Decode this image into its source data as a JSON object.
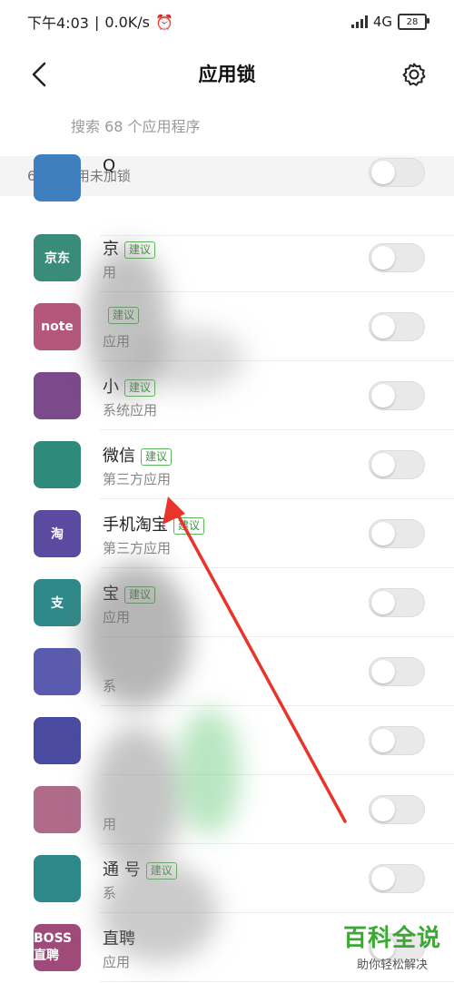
{
  "status_bar": {
    "time": "下午4:03",
    "speed": "0.0K/s",
    "network": "4G",
    "battery": "28"
  },
  "app_bar": {
    "title": "应用锁"
  },
  "search": {
    "placeholder": "搜索 68 个应用程序"
  },
  "section": {
    "header": "63 个应用未加锁"
  },
  "apps": [
    {
      "name": "Q",
      "tag": "",
      "subtitle": "",
      "icon_text": "",
      "icon_color": "#3f7fc0",
      "locked": false
    },
    {
      "name": "京",
      "tag": "建议",
      "subtitle": "用",
      "icon_text": "京东",
      "icon_color": "#3a8c7a",
      "locked": false
    },
    {
      "name": "",
      "tag": "建议",
      "subtitle": "应用",
      "icon_text": "note",
      "icon_color": "#b5577a",
      "locked": false
    },
    {
      "name": "小",
      "tag": "建议",
      "subtitle": "系统应用",
      "icon_text": "",
      "icon_color": "#7a4a8a",
      "locked": false
    },
    {
      "name": "微信",
      "tag": "建议",
      "subtitle": "第三方应用",
      "icon_text": "",
      "icon_color": "#2e8a7a",
      "locked": false
    },
    {
      "name": "手机淘宝",
      "tag": "建议",
      "subtitle": "第三方应用",
      "icon_text": "淘",
      "icon_color": "#5a4aa0",
      "locked": false
    },
    {
      "name": "宝",
      "tag": "建议",
      "subtitle": "应用",
      "icon_text": "支",
      "icon_color": "#2e8a8a",
      "locked": false
    },
    {
      "name": "",
      "tag": "",
      "subtitle": "系",
      "icon_text": "",
      "icon_color": "#5a5ab0",
      "locked": false
    },
    {
      "name": "",
      "tag": "",
      "subtitle": "",
      "icon_text": "",
      "icon_color": "#4a4aa0",
      "locked": false
    },
    {
      "name": "",
      "tag": "",
      "subtitle": "用",
      "icon_text": "",
      "icon_color": "#b06a8a",
      "locked": false
    },
    {
      "name": "通 号",
      "tag": "建议",
      "subtitle": "系",
      "icon_text": "",
      "icon_color": "#2e8a8a",
      "locked": false
    },
    {
      "name": "直聘",
      "tag": "",
      "subtitle": "应用",
      "icon_text": "BOSS直聘",
      "icon_color": "#a04a7a",
      "locked": false
    }
  ],
  "watermark": {
    "main": "百科全说",
    "sub": "助你轻松解决"
  },
  "icons": {
    "back": "back-arrow-icon",
    "settings": "gear-icon"
  }
}
